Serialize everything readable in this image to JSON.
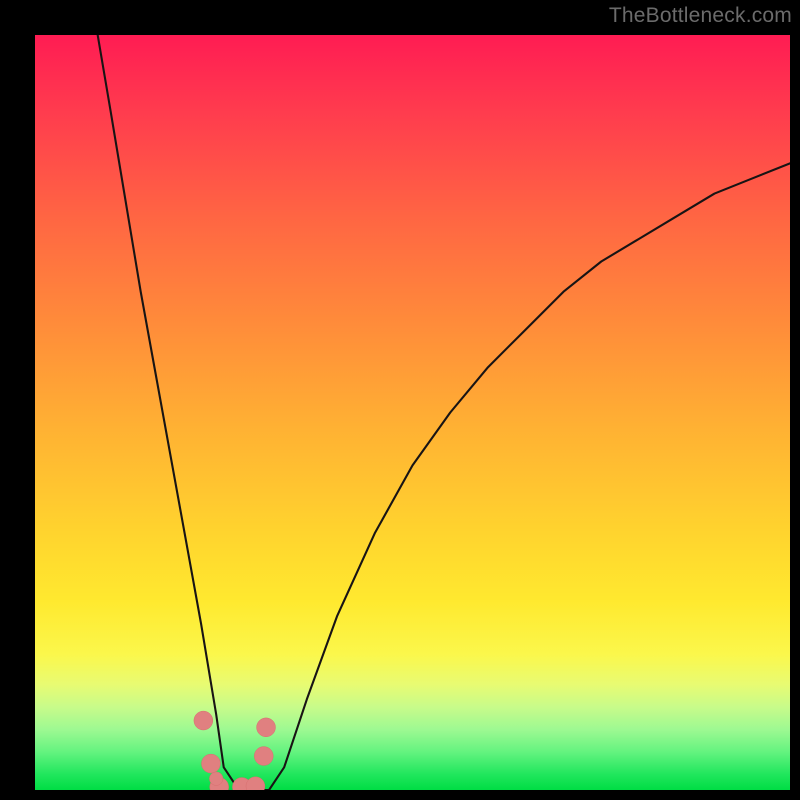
{
  "watermark": {
    "text": "TheBottleneck.com"
  },
  "colors": {
    "curve_stroke": "#181414",
    "marker_fill": "#e08080",
    "marker_stroke": "#d86f6f",
    "gradient_top": "#ff1c53",
    "gradient_bottom": "#00dd44",
    "frame": "#000000"
  },
  "chart_data": {
    "type": "line",
    "title": "",
    "xlabel": "",
    "ylabel": "",
    "xlim": [
      0,
      100
    ],
    "ylim": [
      0,
      100
    ],
    "grid": false,
    "legend": false,
    "description": "Single V-shaped bottleneck curve on a vertical rainbow gradient. The curve falls steeply from the top-left, reaches zero near x≈25, stays at zero until x≈31, then rises with decreasing slope toward the top-right (ending near y≈83 at x=100). A cluster of salmon-pink markers sits around the bottom of the V.",
    "series": [
      {
        "name": "bottleneck-curve",
        "x": [
          8.3,
          10,
          12,
          14,
          16,
          18,
          20,
          22,
          24,
          25,
          27,
          29,
          31,
          33,
          36,
          40,
          45,
          50,
          55,
          60,
          65,
          70,
          75,
          80,
          85,
          90,
          95,
          100
        ],
        "y": [
          100,
          90,
          78,
          66,
          55,
          44,
          33,
          22,
          10,
          3,
          0,
          0,
          0,
          3,
          12,
          23,
          34,
          43,
          50,
          56,
          61,
          66,
          70,
          73,
          76,
          79,
          81,
          83
        ]
      }
    ],
    "markers": {
      "name": "highlight-points",
      "x": [
        22.3,
        23.3,
        24.4,
        27.4,
        29.2,
        30.3,
        30.6,
        24.0
      ],
      "y": [
        9.2,
        3.5,
        0.4,
        0.4,
        0.5,
        4.5,
        8.3,
        1.5
      ],
      "r": [
        1.25,
        1.25,
        1.25,
        1.25,
        1.25,
        1.25,
        1.25,
        0.9
      ]
    }
  }
}
